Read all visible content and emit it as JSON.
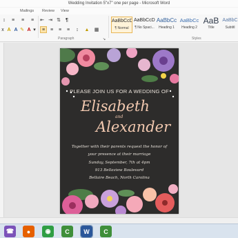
{
  "window": {
    "title": "Wedding Invitation 5\"x7\" one per page - Microsoft Word"
  },
  "ribbon": {
    "tabs": [
      "Mailings",
      "Review",
      "View"
    ],
    "group_labels": {
      "paragraph": "Paragraph",
      "styles": "Styles"
    },
    "styles": [
      {
        "sample": "AaBbCcDc",
        "name": "¶ Normal",
        "active": true
      },
      {
        "sample": "AaBbCcDc",
        "name": "¶ No Spaci...",
        "active": false
      },
      {
        "sample": "AaBbCc",
        "name": "Heading 1",
        "active": false
      },
      {
        "sample": "AaBbCc",
        "name": "Heading 2",
        "active": false
      },
      {
        "sample": "AaB",
        "name": "Title",
        "active": false
      },
      {
        "sample": "AaBbC",
        "name": "Subtitl",
        "active": false
      }
    ]
  },
  "invitation": {
    "intro": "PLEASE JOIN US FOR A WEDDING OF",
    "name1": "Elisabeth",
    "and": "and",
    "name2": "Alexander",
    "lines": [
      "Together with their parents request the honor of",
      "your presence at their marriage",
      "Sunday, September, 7th at 4pm",
      "913 Bellaview Boulevard",
      "Bellaire Beach, North Carolina"
    ]
  },
  "taskbar": {
    "apps": [
      {
        "name": "viber-icon",
        "glyph": "☎",
        "color": "#7b52b9"
      },
      {
        "name": "firefox-icon",
        "glyph": "●",
        "color": "#e66000"
      },
      {
        "name": "chrome-icon",
        "glyph": "◉",
        "color": "#2f9e44"
      },
      {
        "name": "camtasia-icon",
        "glyph": "C",
        "color": "#3f8f3a"
      },
      {
        "name": "word-icon",
        "glyph": "W",
        "color": "#2b579a"
      },
      {
        "name": "camtasia-recorder-icon",
        "glyph": "C",
        "color": "#3f8f3a"
      }
    ]
  }
}
